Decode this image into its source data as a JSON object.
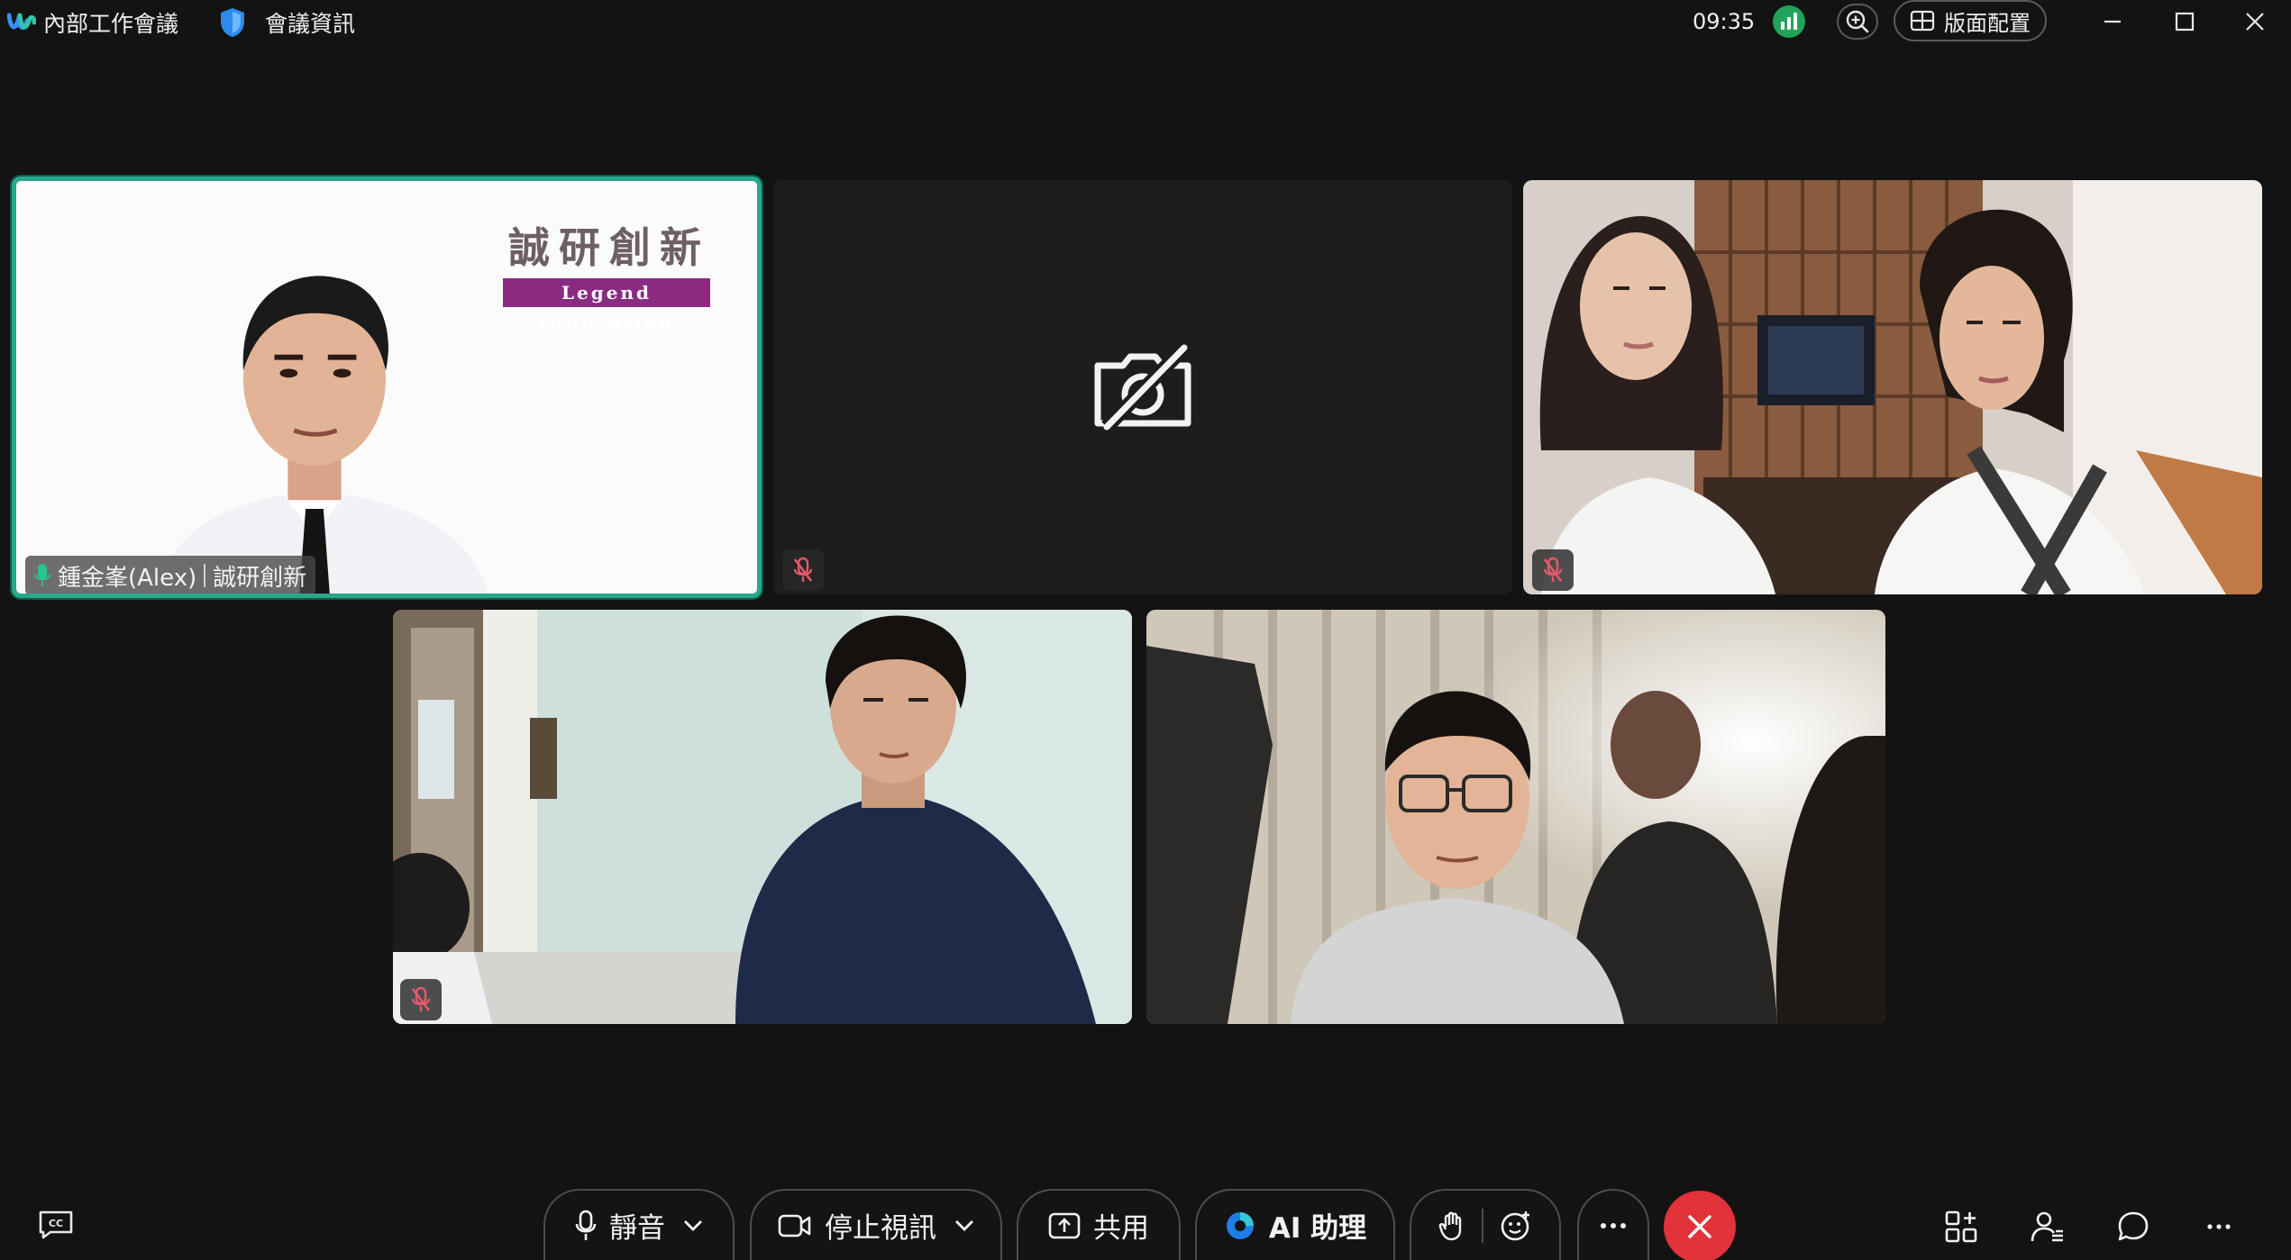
{
  "titlebar": {
    "meeting_title": "內部工作會議",
    "info_label": "會議資訊",
    "clock": "09:35",
    "layout_label": "版面配置"
  },
  "participants": {
    "host_name": "鍾金峯(Alex)",
    "host_org": "誠研創新",
    "host_brand_cn": "誠研創新",
    "host_brand_en": "Legend Innovation"
  },
  "controls": {
    "mute_label": "靜音",
    "stop_video_label": "停止視訊",
    "share_label": "共用",
    "ai_label": "AI 助理"
  },
  "colors": {
    "active_border": "#2aa78b",
    "end_call": "#e2323a",
    "signal": "#21a35a",
    "brand_purple": "#8a2b82"
  }
}
